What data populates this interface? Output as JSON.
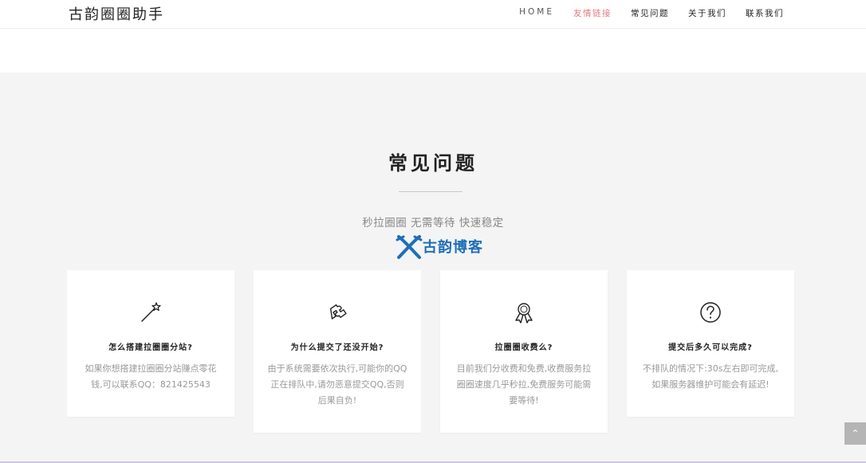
{
  "header": {
    "brand": "古韵圈圈助手",
    "nav": [
      {
        "label": "HOME"
      },
      {
        "label": "友情链接"
      },
      {
        "label": "常见问题"
      },
      {
        "label": "关于我们"
      },
      {
        "label": "联系我们"
      }
    ],
    "active_color": "#e07c7c"
  },
  "faq": {
    "title": "常见问题",
    "subtitle": "秒拉圈圈 无需等待 快速稳定",
    "logo_text": "古韵博客",
    "logo_color": "#1e6fb8",
    "cards": [
      {
        "icon": "magic-wand-icon",
        "title": "怎么搭建拉圈圈分站?",
        "text": "如果你想搭建拉圈圈分站赚点零花钱,可以联系QQ：821425543"
      },
      {
        "icon": "puzzle-icon",
        "title": "为什么提交了还没开始?",
        "text": "由于系统需要依次执行,可能你的QQ正在排队中,请勿恶意提交QQ,否则后果自负!"
      },
      {
        "icon": "award-ribbon-icon",
        "title": "拉圈圈收费么?",
        "text": "目前我们分收费和免费,收费服务拉圈圈速度几乎秒拉,免费服务可能需要等待!"
      },
      {
        "icon": "question-circle-icon",
        "title": "提交后多久可以完成?",
        "text": "不排队的情况下:30s左右即可完成,如果服务器维护可能会有延迟!"
      }
    ]
  },
  "back_to_top": {
    "icon": "chevron-up-icon",
    "label": "⌃"
  }
}
